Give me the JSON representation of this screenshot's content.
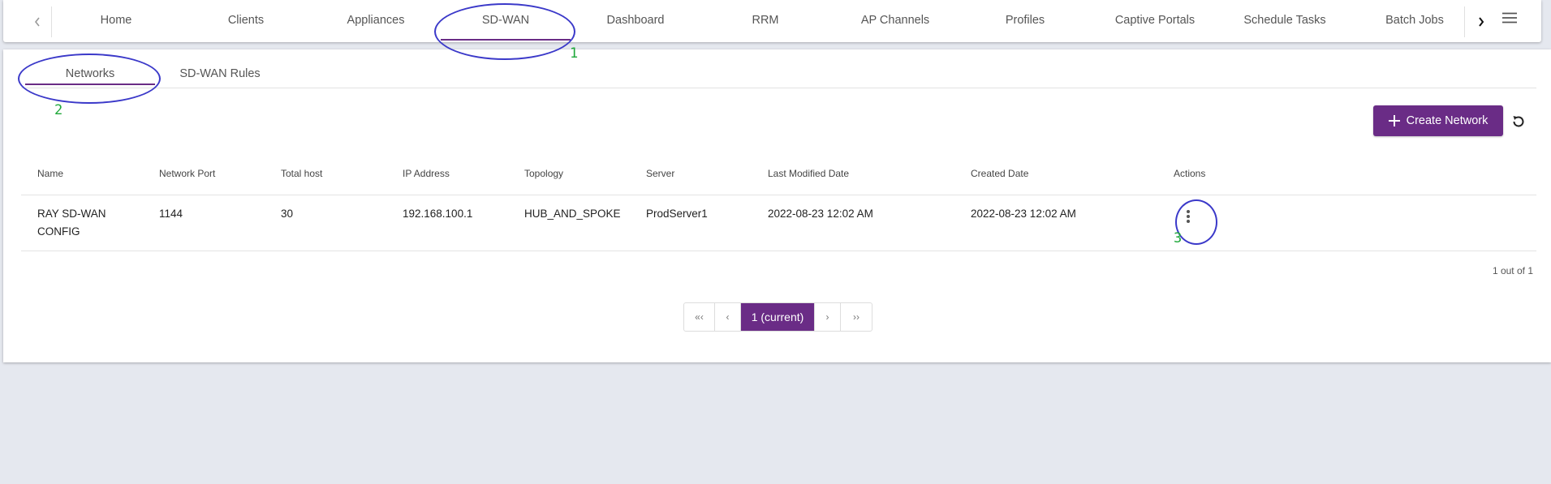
{
  "top_nav": {
    "tabs": [
      "Home",
      "Clients",
      "Appliances",
      "SD-WAN",
      "Dashboard",
      "RRM",
      "AP Channels",
      "Profiles",
      "Captive Portals",
      "Schedule Tasks",
      "Batch Jobs"
    ],
    "active": "SD-WAN",
    "prev_icon": "chevron-left-icon",
    "next_icon": "chevron-right-icon",
    "menu_icon": "menu-icon"
  },
  "sub_tabs": {
    "tabs": [
      "Networks",
      "SD-WAN Rules"
    ],
    "active": "Networks"
  },
  "toolbar": {
    "create_label": "Create Network",
    "create_icon": "plus-icon",
    "refresh_icon": "refresh-icon"
  },
  "table": {
    "columns": [
      "Name",
      "Network Port",
      "Total host",
      "IP Address",
      "Topology",
      "Server",
      "Last Modified Date",
      "Created Date",
      "Actions"
    ],
    "rows": [
      {
        "name_line1": "RAY SD-WAN",
        "name_line2": "CONFIG",
        "network_port": "1144",
        "total_host": "30",
        "ip_address": "192.168.100.1",
        "topology": "HUB_AND_SPOKE",
        "server": "ProdServer1",
        "last_modified": "2022-08-23 12:02 AM",
        "created": "2022-08-23 12:02 AM",
        "actions_icon": "more-vertical-icon"
      }
    ],
    "count_text": "1 out of 1"
  },
  "pagination": {
    "first": "«‹",
    "prev": "‹",
    "current": "1 (current)",
    "next": "›",
    "last": "››"
  },
  "annotations": [
    "1",
    "2",
    "3"
  ],
  "colors": {
    "accent": "#6a2c86",
    "annotation_ellipse": "#3b39c9",
    "annotation_number": "#1fa83a"
  }
}
